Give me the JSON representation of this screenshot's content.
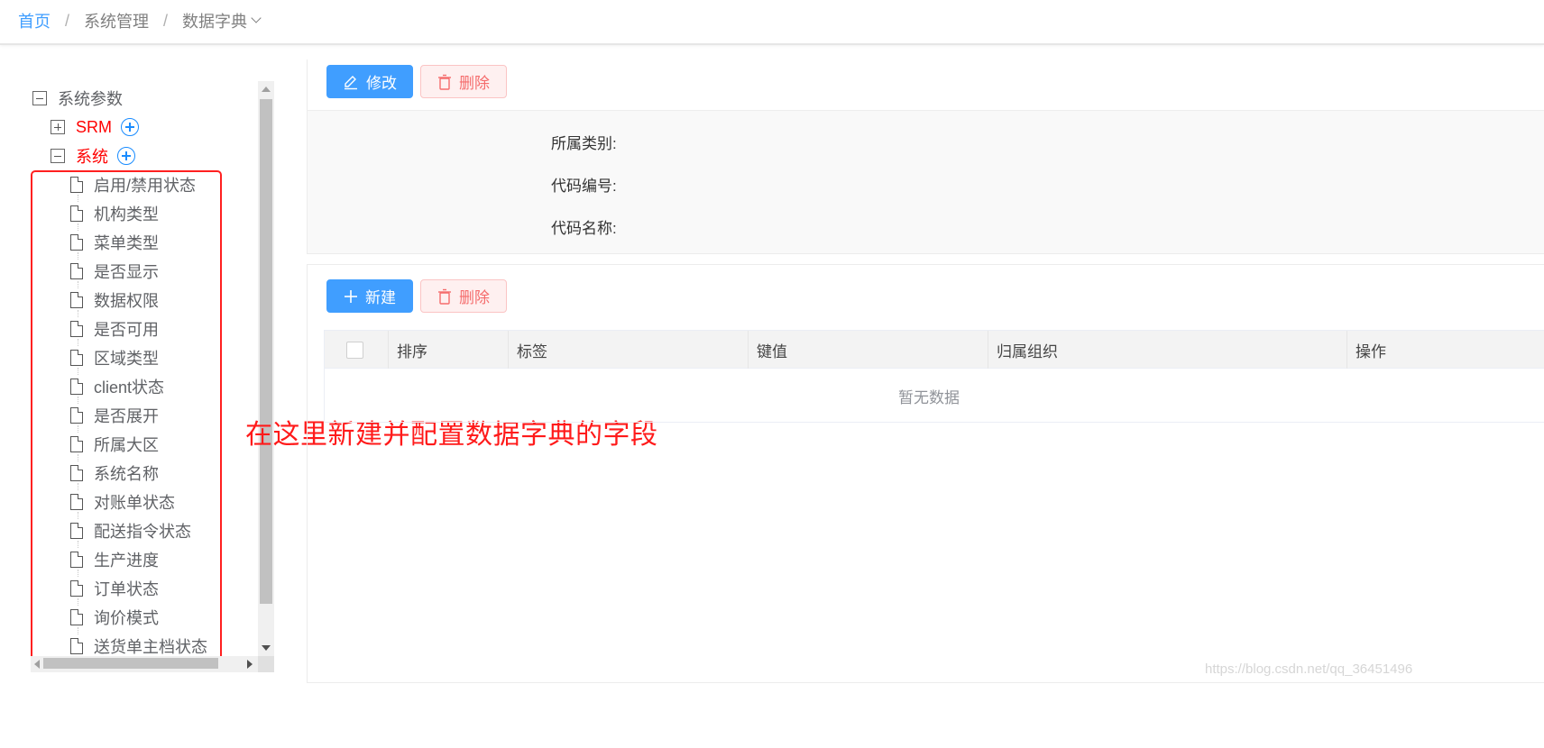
{
  "breadcrumb": {
    "home": "首页",
    "separator": "/",
    "level1": "系统管理",
    "level2": "数据字典"
  },
  "tree": {
    "root": {
      "label": "系统参数",
      "state": "expanded"
    },
    "srm": {
      "label": "SRM",
      "state": "collapsed"
    },
    "system": {
      "label": "系统",
      "state": "expanded"
    },
    "leaves": [
      "启用/禁用状态",
      "机构类型",
      "菜单类型",
      "是否显示",
      "数据权限",
      "是否可用",
      "区域类型",
      "client状态",
      "是否展开",
      "所属大区",
      "系统名称",
      "对账单状态",
      "配送指令状态",
      "生产进度",
      "订单状态",
      "询价模式",
      "送货单主档状态"
    ]
  },
  "annotation": "在这里新建并配置数据字典的字段",
  "detail": {
    "edit_label": "修改",
    "delete_label": "删除",
    "fields": {
      "category": "所属类别:",
      "code": "代码编号:",
      "name": "代码名称:"
    }
  },
  "list": {
    "new_label": "新建",
    "delete_label": "删除",
    "columns": [
      "排序",
      "标签",
      "键值",
      "归属组织",
      "操作"
    ],
    "empty_text": "暂无数据"
  },
  "watermark": "https://blog.csdn.net/qq_36451496",
  "colors": {
    "primary": "#409eff",
    "danger": "#f56c6c",
    "highlight": "#ff2020",
    "tree_node_red": "#ff0000"
  }
}
